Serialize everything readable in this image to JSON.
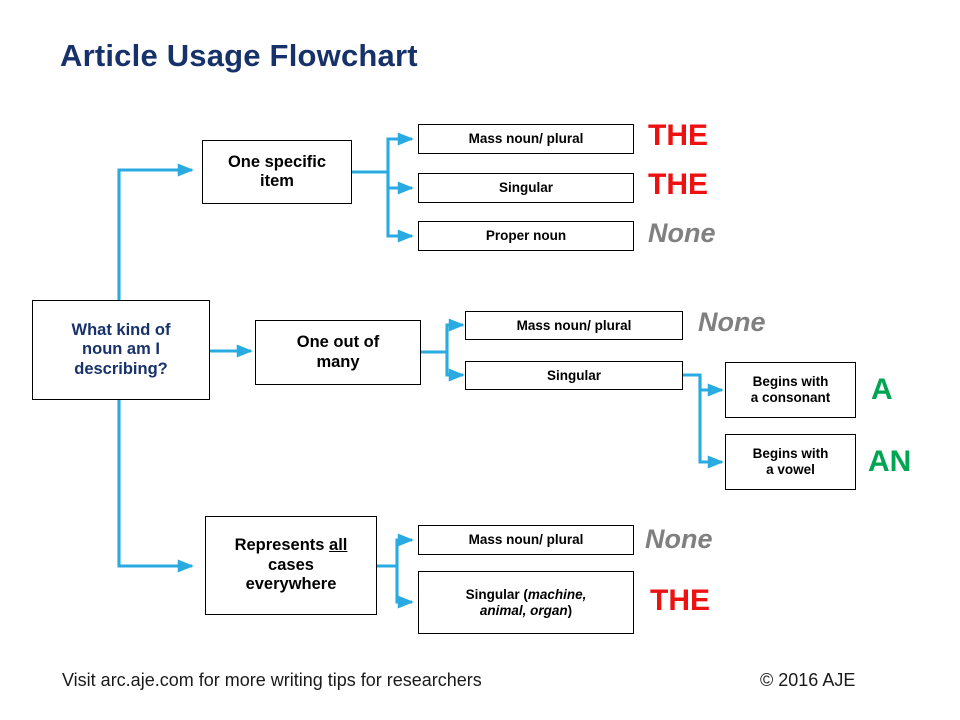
{
  "title": "Article Usage Flowchart",
  "colors": {
    "title": "#17326b",
    "connector": "#29abe2",
    "the": "#ee1111",
    "none": "#808080",
    "article": "#00a551",
    "box_border": "#000000",
    "box_text": "#000000",
    "question_text": "#17326b"
  },
  "root": {
    "label": "What kind of noun am I describing?",
    "line1": "What kind of",
    "line2": "noun am I",
    "line3": "describing?"
  },
  "branches": [
    {
      "id": "one-specific-item",
      "label": "One specific item",
      "line1": "One specific",
      "line2": "item",
      "options": [
        {
          "label": "Mass noun/ plural",
          "article": "THE",
          "article_type": "the"
        },
        {
          "label": "Singular",
          "article": "THE",
          "article_type": "the"
        },
        {
          "label": "Proper noun",
          "article": "None",
          "article_type": "none"
        }
      ]
    },
    {
      "id": "one-out-of-many",
      "label": "One out of many",
      "line1": "One out of",
      "line2": "many",
      "options": [
        {
          "label": "Mass noun/ plural",
          "article": "None",
          "article_type": "none"
        },
        {
          "label": "Singular",
          "article": "",
          "article_type": ""
        }
      ],
      "sub_options": [
        {
          "label": "Begins with a consonant",
          "line1": "Begins with",
          "line2": "a consonant",
          "article": "A",
          "article_type": "art"
        },
        {
          "label": "Begins with a vowel",
          "line1": "Begins with",
          "line2": "a vowel",
          "article": "AN",
          "article_type": "art"
        }
      ]
    },
    {
      "id": "represents-all-cases",
      "label": "Represents all cases everywhere",
      "line1_pre": "Represents ",
      "line1_underlined": "all",
      "line2": "cases",
      "line3": "everywhere",
      "options": [
        {
          "label": "Mass noun/ plural",
          "article": "None",
          "article_type": "none"
        },
        {
          "label": "Singular (machine, animal, organ)",
          "line1_pre": "Singular (",
          "line1_italic": "machine,",
          "line2_italic": "animal, organ",
          "line2_post": ")",
          "article": "THE",
          "article_type": "the"
        }
      ]
    }
  ],
  "footer": {
    "left": "Visit arc.aje.com for more writing tips for researchers",
    "right": "© 2016 AJE"
  }
}
